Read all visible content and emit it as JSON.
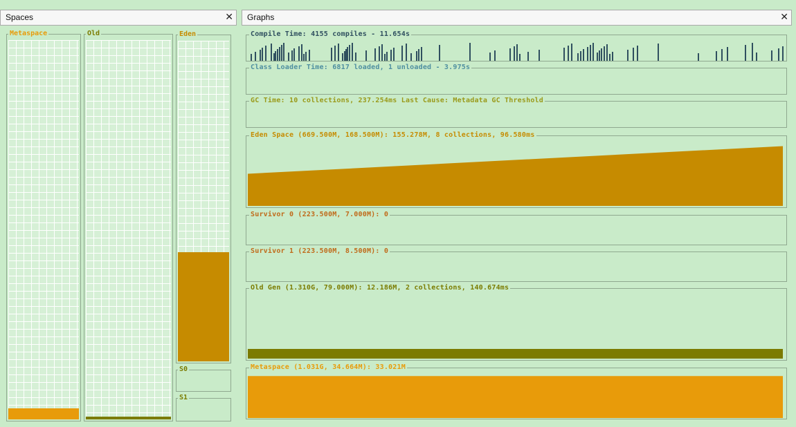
{
  "spaces_panel": {
    "title": "Spaces"
  },
  "graphs_panel": {
    "title": "Graphs"
  },
  "spaces": {
    "metaspace": {
      "label": "Metaspace",
      "fill_fraction": 0.03,
      "color": "#e89b0a"
    },
    "old": {
      "label": "Old",
      "fill_fraction": 0.008,
      "color": "#7b7b00"
    },
    "eden": {
      "label": "Eden",
      "fill_fraction": 0.34,
      "color": "#c68b00"
    },
    "s0": {
      "label": "S0"
    },
    "s1": {
      "label": "S1"
    }
  },
  "graphs": {
    "compile_time": {
      "title": "Compile Time: 4155 compiles - 11.654s",
      "color": "#2f4f5f"
    },
    "class_loader": {
      "title": "Class Loader Time: 6817 loaded, 1 unloaded - 3.975s",
      "color": "#4f8fa0"
    },
    "gc_time": {
      "title": "GC Time: 10 collections, 237.254ms Last Cause: Metadata GC Threshold",
      "color": "#9a9a1a"
    },
    "eden_space": {
      "title": "Eden Space (669.500M, 168.500M): 155.278M, 8 collections, 96.580ms",
      "color": "#c68b00",
      "start_level": 0.5,
      "end_level": 0.93
    },
    "survivor0": {
      "title": "Survivor 0 (223.500M, 7.000M): 0",
      "color": "#c06a1a"
    },
    "survivor1": {
      "title": "Survivor 1 (223.500M, 8.500M): 0",
      "color": "#c06a1a"
    },
    "old_gen": {
      "title": "Old Gen (1.310G, 79.000M): 12.186M, 2 collections, 140.674ms",
      "color": "#7b7b00",
      "level": 0.15
    },
    "metaspace": {
      "title": "Metaspace (1.031G, 34.664M): 33.021M",
      "color": "#e89b0a",
      "level": 0.95
    }
  }
}
